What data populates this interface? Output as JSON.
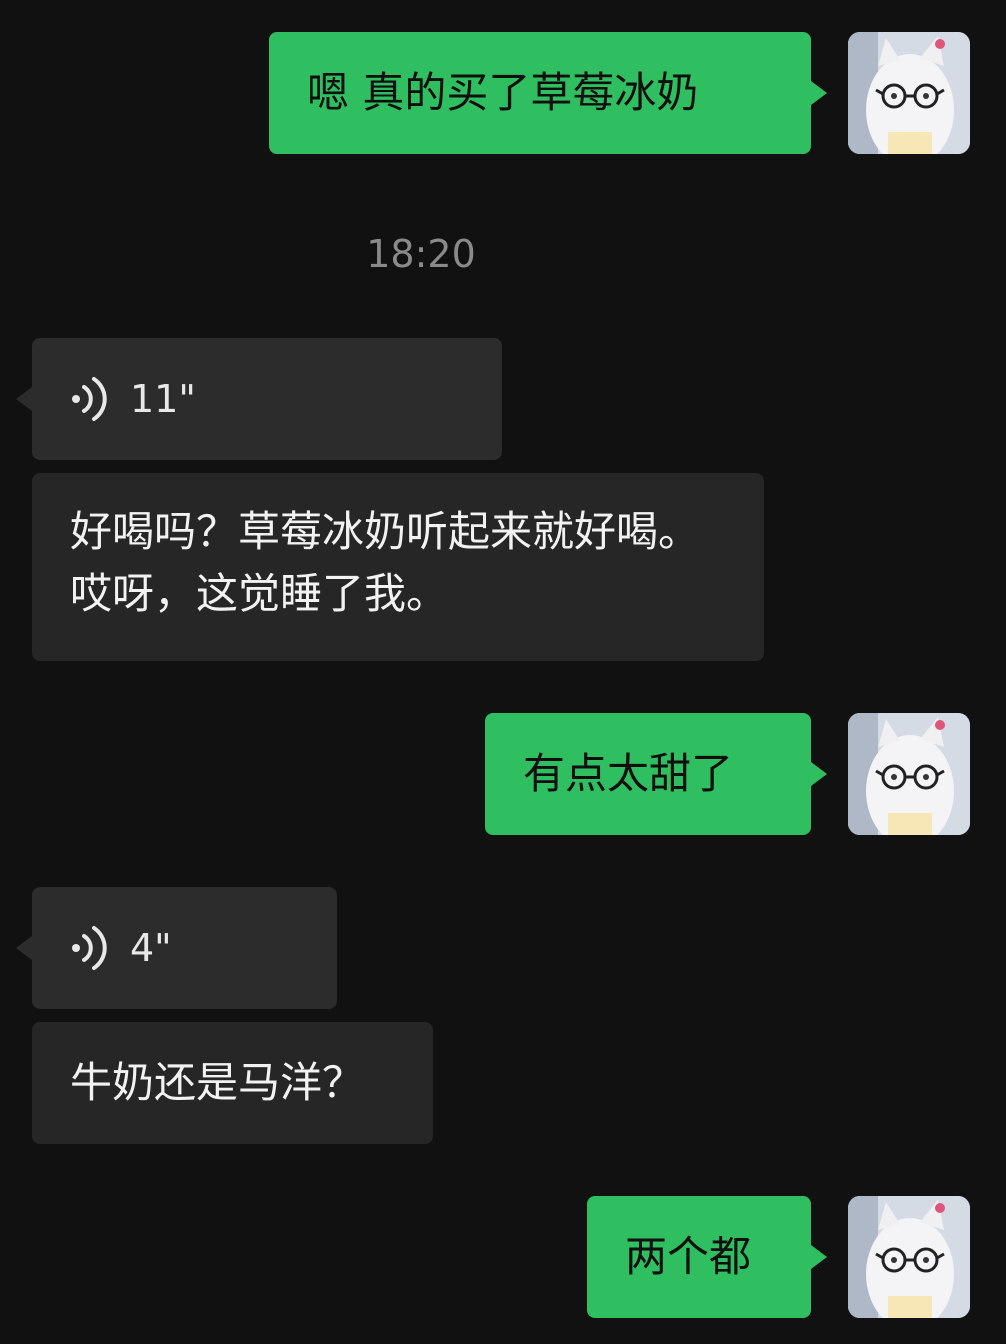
{
  "messages": {
    "m1": {
      "text": "嗯 真的买了草莓冰奶"
    },
    "time": "18:20",
    "m2": {
      "duration": "11\""
    },
    "m3": {
      "text": "好喝吗？草莓冰奶听起来就好喝。哎呀，这觉睡了我。"
    },
    "m4": {
      "text": "有点太甜了"
    },
    "m5": {
      "duration": "4\""
    },
    "m6": {
      "text": "牛奶还是马洋？"
    },
    "m7": {
      "text": "两个都"
    }
  },
  "colors": {
    "background": "#111111",
    "outgoing_bubble": "#2fbf60",
    "incoming_bubble": "#262626",
    "voice_bubble": "#2c2c2c",
    "timestamp": "#8a8a8a"
  },
  "icons": {
    "voice": "voice-wave-icon",
    "avatar": "cat-with-glasses-avatar"
  }
}
